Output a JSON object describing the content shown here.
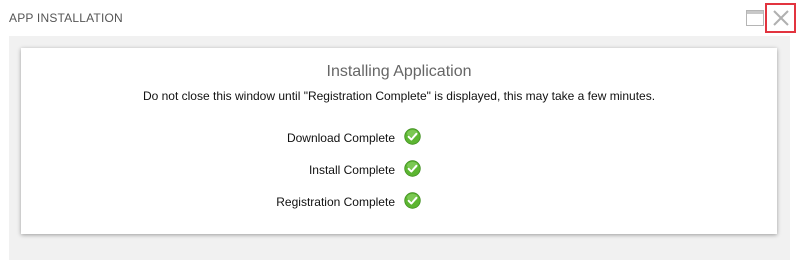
{
  "window": {
    "title": "APP INSTALLATION",
    "maximize_icon": "maximize-icon",
    "close_icon": "close-icon"
  },
  "content": {
    "heading": "Installing Application",
    "note": "Do not close this window until \"Registration Complete\" is displayed, this may take a few minutes.",
    "steps": [
      {
        "label": "Download Complete",
        "status": "complete",
        "icon": "check-circle-icon"
      },
      {
        "label": "Install Complete",
        "status": "complete",
        "icon": "check-circle-icon"
      },
      {
        "label": "Registration Complete",
        "status": "complete",
        "icon": "check-circle-icon"
      }
    ]
  },
  "colors": {
    "close_highlight": "#e2343f",
    "check_green": "#5cb531",
    "body_background": "#f1f1f1"
  }
}
